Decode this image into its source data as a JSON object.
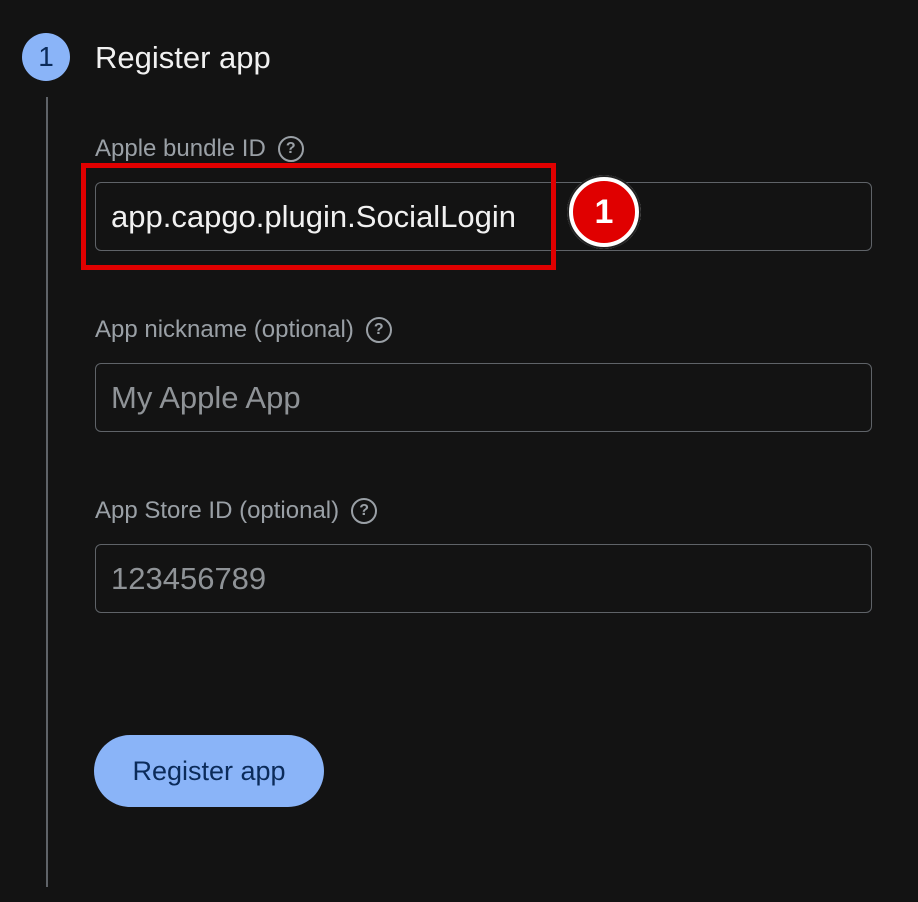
{
  "step": {
    "number": "1",
    "title": "Register app"
  },
  "fields": {
    "bundle_id": {
      "label": "Apple bundle ID",
      "value": "app.capgo.plugin.SocialLogin"
    },
    "nickname": {
      "label": "App nickname (optional)",
      "placeholder": "My Apple App"
    },
    "store_id": {
      "label": "App Store ID (optional)",
      "placeholder": "123456789"
    }
  },
  "help_glyph": "?",
  "annotation": {
    "number": "1",
    "color": "#e00000"
  },
  "actions": {
    "register_label": "Register app"
  },
  "colors": {
    "accent": "#8ab4f8",
    "background": "#131313"
  }
}
